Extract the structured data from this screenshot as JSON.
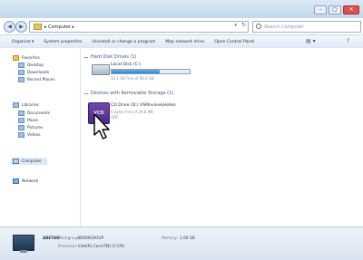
{
  "window": {
    "caption_buttons": {
      "min": "–",
      "max": "▢",
      "close": "✕"
    }
  },
  "address_bar": {
    "path": "▸ Computer ▸",
    "dropdown": "▾",
    "refresh": "↻",
    "search_placeholder": "Search Computer"
  },
  "nav_buttons": {
    "back": "◀",
    "forward": "▶"
  },
  "toolbar": {
    "items": [
      "Organize ▾",
      "System properties",
      "Uninstall or change a program",
      "Map network drive",
      "Open Control Panel"
    ],
    "view": "▤ ▾",
    "help": "?"
  },
  "sidebar": {
    "favorites": "Favorites",
    "desktop": "Desktop",
    "downloads": "Downloads",
    "recent": "Recent Places",
    "libraries": "Libraries",
    "documents": "Documents",
    "music": "Music",
    "pictures": "Pictures",
    "videos": "Videos",
    "computer": "Computer",
    "network": "Network"
  },
  "main": {
    "hdd_group": "Hard Disk Drives (1)",
    "hdd_name": "Local Disk (C:)",
    "hdd_usage_percent": 62,
    "hdd_free": "33.1 GB free of 58.0 GB",
    "removable_group": "Devices with Removable Storage (1)",
    "cd_label": "VCD",
    "cd_name": "CD Drive (D:) VSMovies&Helles",
    "cd_sub1": "0 bytes free of 29.8 MB",
    "cd_sub2": "UDF"
  },
  "details": {
    "name": "ABETAN",
    "workgroup_label": "Workgroup:",
    "workgroup_value": "WORKGROUP",
    "memory_label": "Memory:",
    "memory_value": "1.00 GB",
    "processor_label": "Processor:",
    "processor_value": "Intel(R) Core(TM) i5 CPU"
  }
}
